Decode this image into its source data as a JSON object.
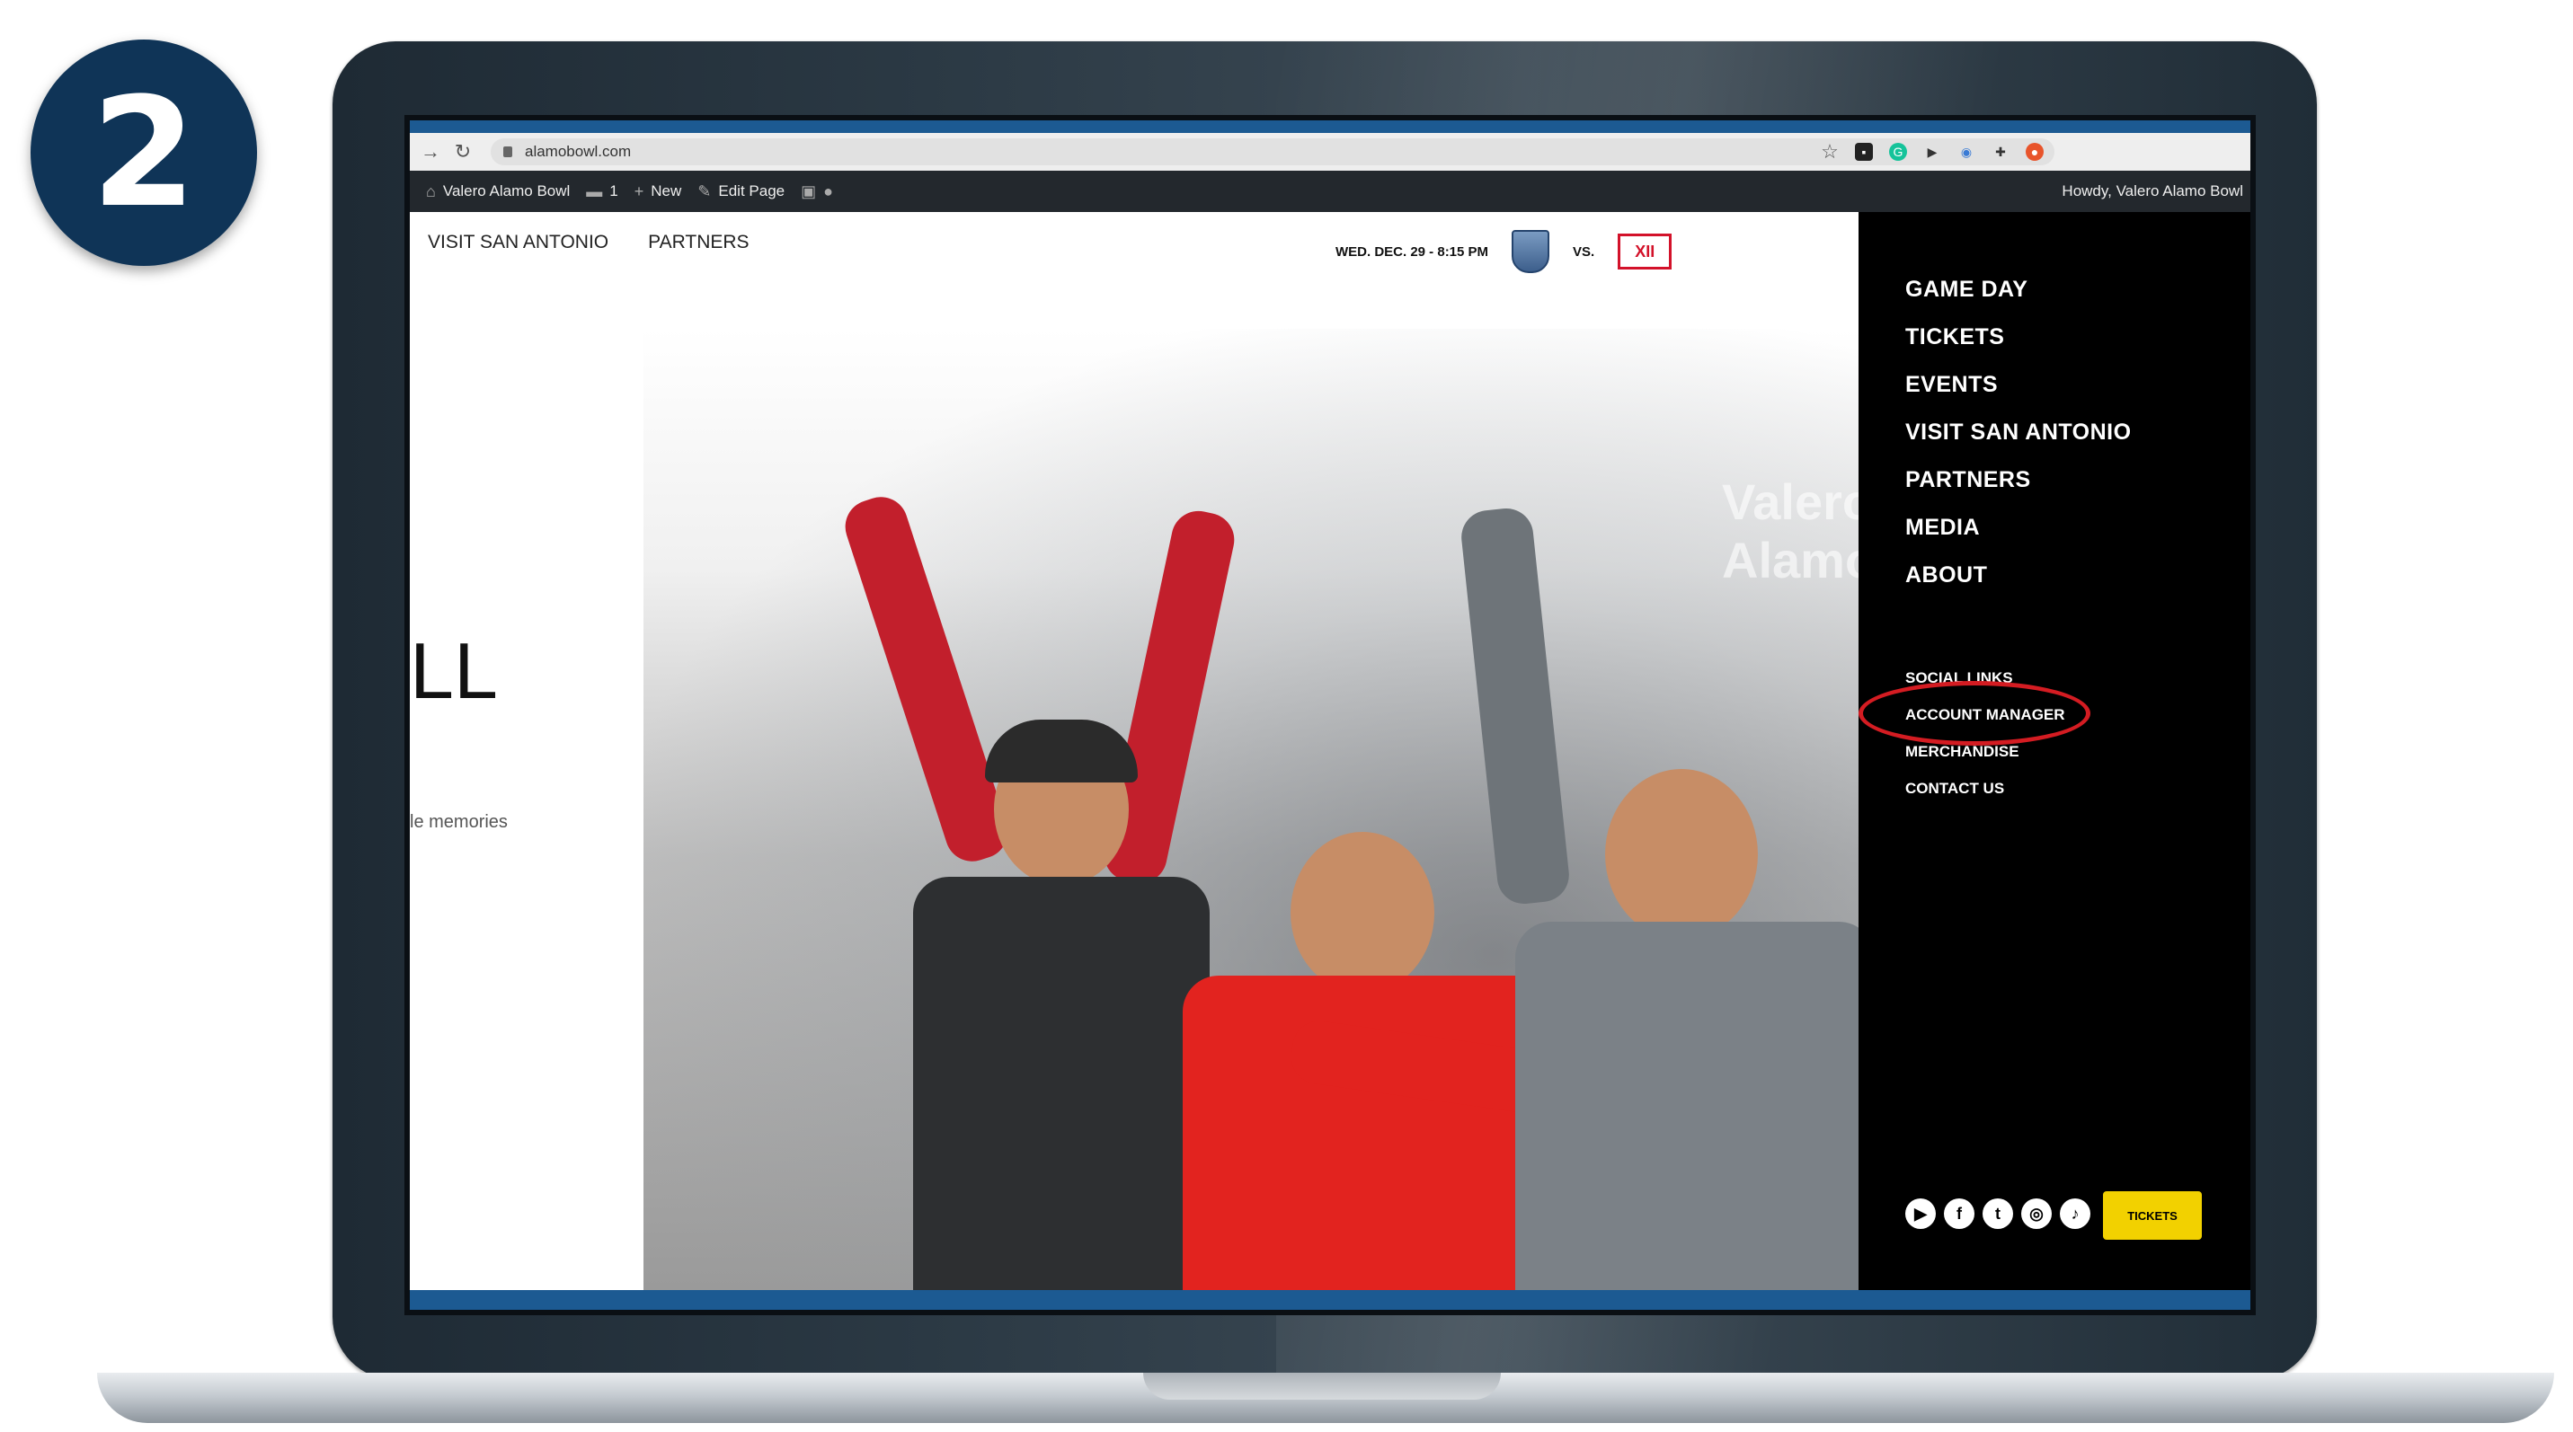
{
  "step": {
    "number": "2"
  },
  "browser": {
    "url": "alamobowl.com",
    "back_icon": "arrow-right-icon",
    "reload_icon": "reload-icon"
  },
  "admin_bar": {
    "site_name": "Valero Alamo Bowl",
    "comments_count": "1",
    "new_label": "New",
    "edit_label": "Edit Page",
    "greeting": "Howdy, Valero Alamo Bowl"
  },
  "top_nav": {
    "items": [
      "VISIT SAN ANTONIO",
      "PARTNERS"
    ]
  },
  "matchup": {
    "date_text": "WED. DEC. 29 - 8:15 PM",
    "vs_text": "VS.",
    "team2_logo_text": "XII"
  },
  "hero": {
    "title_partial": "LL",
    "subtitle_partial": "le memories",
    "banner_text": "Valero Alamo"
  },
  "side_menu": {
    "main_items": [
      "GAME DAY",
      "TICKETS",
      "EVENTS",
      "VISIT SAN ANTONIO",
      "PARTNERS",
      "MEDIA",
      "ABOUT"
    ],
    "sub_items": [
      "SOCIAL LINKS",
      "ACCOUNT MANAGER",
      "MERCHANDISE",
      "CONTACT US"
    ],
    "highlight_color": "#d41c22",
    "social_icons": [
      "youtube-icon",
      "facebook-icon",
      "twitter-icon",
      "instagram-icon",
      "tiktok-icon"
    ],
    "tickets_label": "TICKETS"
  }
}
